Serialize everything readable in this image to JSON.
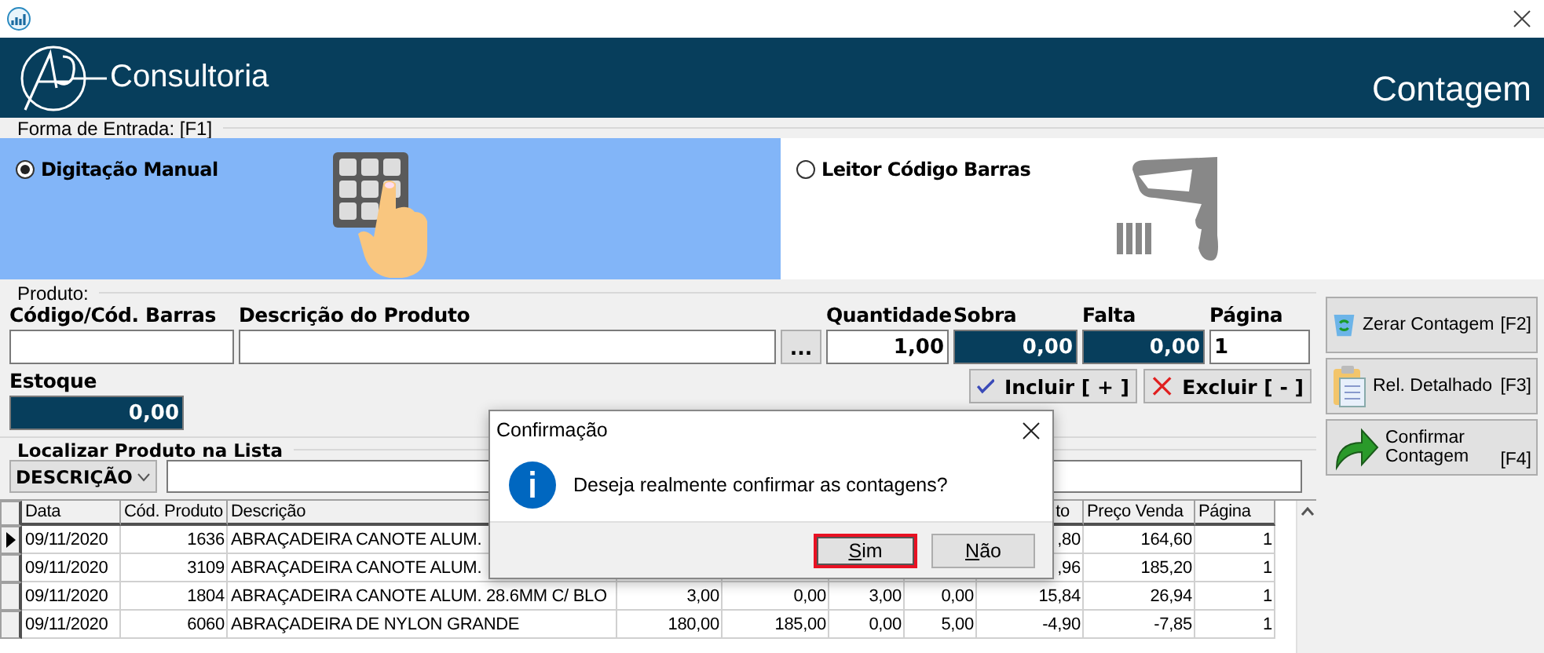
{
  "header": {
    "brand": "Consultoria",
    "title": "Contagem"
  },
  "entry_mode": {
    "legend": "Forma de Entrada: [F1]",
    "options": [
      {
        "label": "Digitação Manual",
        "selected": true
      },
      {
        "label": "Leitor Código Barras",
        "selected": false
      }
    ]
  },
  "product": {
    "legend": "Produto:",
    "fields": [
      {
        "kind": "input",
        "label": "Código/Cód. Barras"
      },
      {
        "kind": "input",
        "label": "Descrição do Produto"
      },
      {
        "kind": "lookup",
        "text": "..."
      },
      {
        "kind": "quantity",
        "label": "Quantidade",
        "value": "1,00"
      },
      {
        "kind": "readout",
        "label": "Sobra",
        "value": "0,00"
      },
      {
        "kind": "readout",
        "label": "Falta",
        "value": "0,00"
      },
      {
        "kind": "input",
        "label": "Página",
        "value": "1"
      }
    ],
    "stock": {
      "label": "Estoque",
      "value": "0,00"
    },
    "buttons": [
      {
        "kind": "add",
        "label": "Incluir [ + ]"
      },
      {
        "kind": "remove",
        "label": "Excluir [ - ]"
      }
    ]
  },
  "side_buttons": [
    {
      "kind": "reset",
      "label": "Zerar Contagem",
      "key": "[F2]"
    },
    {
      "kind": "report",
      "label": "Rel. Detalhado",
      "key": "[F3]"
    },
    {
      "kind": "confirm",
      "label": "Confirmar Contagem",
      "key": "[F4]"
    }
  ],
  "search": {
    "legend": "Localizar Produto na Lista",
    "filter": "DESCRIÇÃO"
  },
  "table": {
    "columns": [
      "Data",
      "Cód. Produto",
      "Descrição",
      null,
      null,
      null,
      null,
      "to",
      "Preço Venda",
      "Página"
    ],
    "rows": [
      {
        "current": true,
        "cells": [
          "09/11/2020",
          "1636",
          "ABRAÇADEIRA CANOTE ALUM.",
          null,
          null,
          null,
          null,
          ",80",
          "164,60",
          "1"
        ]
      },
      {
        "current": false,
        "cells": [
          "09/11/2020",
          "3109",
          "ABRAÇADEIRA CANOTE ALUM.",
          null,
          null,
          null,
          null,
          ",96",
          "185,20",
          "1"
        ]
      },
      {
        "current": false,
        "cells": [
          "09/11/2020",
          "1804",
          "ABRAÇADEIRA CANOTE ALUM. 28.6MM C/ BLO",
          "3,00",
          "0,00",
          "3,00",
          "0,00",
          "15,84",
          "26,94",
          "1"
        ]
      },
      {
        "current": false,
        "cells": [
          "09/11/2020",
          "6060",
          "ABRAÇADEIRA DE NYLON GRANDE",
          "180,00",
          "185,00",
          "0,00",
          "5,00",
          "-4,90",
          "-7,85",
          "1"
        ]
      }
    ]
  },
  "dialog": {
    "title": "Confirmação",
    "message": "Deseja realmente confirmar as contagens?",
    "buttons": [
      {
        "label": "Sim",
        "focused": true
      },
      {
        "label": "Não",
        "focused": false
      }
    ]
  }
}
